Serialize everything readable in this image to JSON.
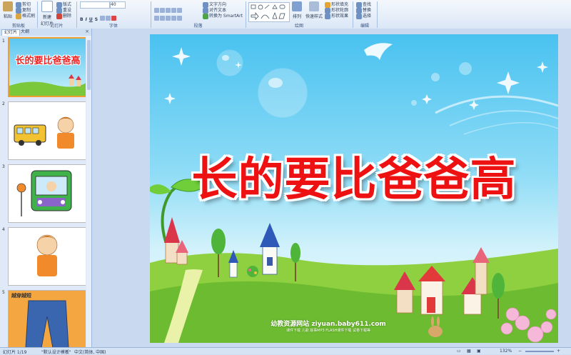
{
  "ribbon": {
    "clipboard": {
      "paste": "粘贴",
      "cut": "剪切",
      "copy": "复制",
      "format_painter": "格式刷"
    },
    "slides": {
      "new_slide": "新建\n幻灯片",
      "layout": "版式",
      "reset": "重设",
      "delete": "删除"
    },
    "font": {
      "font_size": "40"
    },
    "paragraph": {
      "text_direction": "文字方向",
      "align_text": "对齐文本",
      "smartart": "转换为 SmartArt"
    },
    "drawing": {
      "arrange": "排列",
      "quick_styles": "快速样式",
      "shape_fill": "形状填充",
      "shape_outline": "形状轮廓",
      "shape_effects": "形状效果"
    },
    "editing": {
      "find": "查找",
      "replace": "替换",
      "select": "选择"
    },
    "groups": [
      "剪贴板",
      "幻灯片",
      "字体",
      "段落",
      "绘图",
      "编辑"
    ]
  },
  "panel": {
    "tabs": [
      "幻灯片",
      "大纲"
    ],
    "close_icon": "close-icon",
    "thumbnails": [
      {
        "num": "1",
        "text": "长的要比爸爸高",
        "selected": true
      },
      {
        "num": "2",
        "text": "",
        "selected": false
      },
      {
        "num": "3",
        "text": "",
        "selected": false
      },
      {
        "num": "4",
        "text": "",
        "selected": false
      },
      {
        "num": "5",
        "text": "越穿越短",
        "selected": false
      }
    ]
  },
  "slide": {
    "title": "长的要比爸爸高",
    "footer_main": "幼教资源网站  ziyuan.baby611.com",
    "footer_sub": "课件下载  儿歌  故事MP3  FLASH课件下载  试卷下载等"
  },
  "statusbar": {
    "slide_info": "幻灯片 1/19",
    "theme": "\"默认设计模板\"",
    "language": "中文(简体, 中国)",
    "zoom": "132%"
  },
  "colors": {
    "title_red": "#ee1111",
    "sky_top": "#49c2f0",
    "grass": "#7bc83a"
  }
}
